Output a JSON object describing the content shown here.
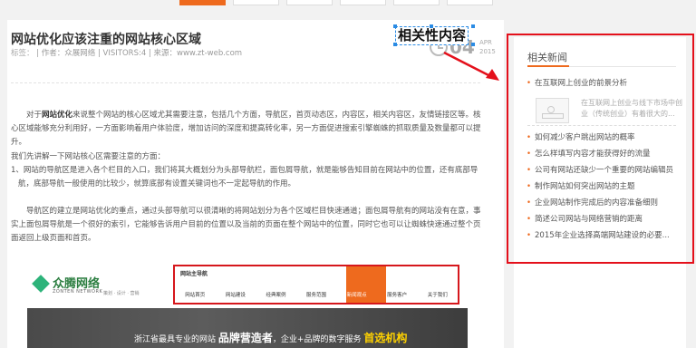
{
  "article": {
    "title": "网站优化应该注重的网站核心区域",
    "meta": {
      "tags": "标签：",
      "author": "| 作者：众展网络 | VISITORS:4 | 来源：www.zt-web.com"
    },
    "date": {
      "day": "04",
      "month": "APR",
      "year": "2015"
    },
    "p1_bold": "网站优化",
    "p1_rest": "来说整个网站的核心区域尤其需要注意，包括几个方面，导航区，首页动态区，内容区，相关内容区，友情链接区等。核心区域能够充分利用好，一方面影响着用户体验度，增加访问的深度和提高转化率，另一方面促进搜索引擎蜘蛛的抓取质量及数量都可以提升。",
    "p1_lead": "对于",
    "p2_intro": "我们先讲解一下网站核心区需要注意的方面：",
    "p2_item": "1、网站的导航区是进入各个栏目的入口，我们将其大概划分为头部导航栏，面包屑导航，就是能够告知目前在网站中的位置，还有底部导航，底部导航一般使用的比较少，就算底部有设置关键词也不一定起导航的作用。",
    "p3": "导航区的建立是网站优化的重点，通过头部导航可以很清晰的将网站划分为各个区域栏目快速通道；面包屑导航有的网站没有在意，事实上面包屑导航是一个很好的索引，它能够告诉用户目前的位置以及当前的页面在整个网站中的位置，同时它也可以让蜘蛛快速通过整个页面返回上级页面和首页。"
  },
  "embed": {
    "logo": "众腾网络",
    "logo_sub": "ZONTEN NETWORK",
    "logo_tags": "策划 · 设计 · 营销",
    "nav_title": "网站主导航",
    "nav_items": [
      "网站首页",
      "网站建设",
      "经典案例",
      "服务范围",
      "新闻观点",
      "服务客户",
      "关于我们"
    ],
    "banner_pre": "浙江省最具专业的网站",
    "banner_big": "品牌营造者",
    "banner_mid": "，企业+品牌的数字服务",
    "banner_end": "首选机构"
  },
  "annotation": {
    "label": "相关性内容"
  },
  "sidebar": {
    "title": "相关新闻",
    "featured_title": "在互联网上创业的前景分析",
    "featured_desc": "在互联网上创业与线下市场中创业（传统创业）有着很大的...",
    "items": [
      "如何减少客户跳出网站的概率",
      "怎么样填写内容才能获得好的流量",
      "公司有网站还缺少一个重要的网站编辑员",
      "制作网站如何突出网站的主题",
      "企业网站制作完成后的内容准备细则",
      "简述公司网站与网络营销的距离",
      "2015年企业选择高端网站建设的必要..."
    ]
  },
  "colors": {
    "accent": "#ee6a1e",
    "highlight_red": "#e4101b",
    "annotation_blue": "#2a8be4"
  }
}
